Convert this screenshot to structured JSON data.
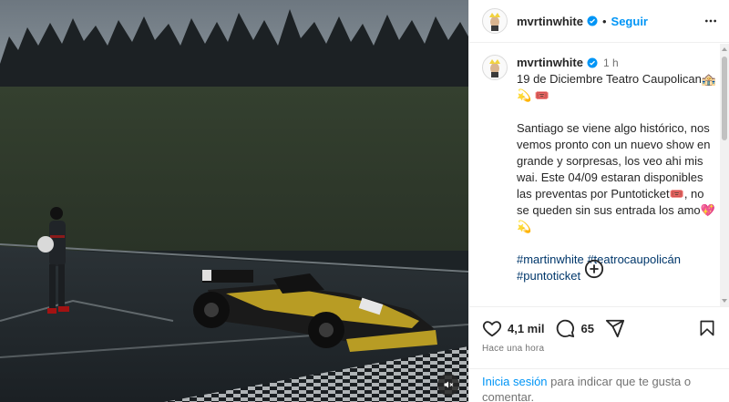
{
  "post": {
    "username": "mvrtinwhite",
    "follow_label": "Seguir",
    "dot": "•",
    "time_ago": "1 h",
    "caption_line1": "19 de Diciembre Teatro Caupolican🏤💫 🎟️",
    "caption_body": "Santiago se viene algo histórico, nos vemos pronto con un nuevo show en grande y sorpresas, los veo ahi mis wai. Este 04/09 estaran disponibles las preventas por Puntoticket🎟️, no se queden sin sus entrada los amo💖 💫",
    "hashtags": [
      "#martinwhite",
      "#teatrocaupolicán",
      "#puntoticket"
    ]
  },
  "actions": {
    "likes": "4,1 mil",
    "comments": "65",
    "posted_label": "Hace una hora"
  },
  "login_prompt": {
    "link": "Inicia sesión",
    "text": " para indicar que te gusta o comentar."
  },
  "icons": {
    "verified": "verified-badge-icon",
    "more": "more-options-icon",
    "like": "heart-icon",
    "comment": "comment-icon",
    "share": "share-icon",
    "save": "bookmark-icon",
    "load_more": "plus-circle-icon",
    "mute": "muted-speaker-icon"
  },
  "colors": {
    "link_blue": "#0095f6",
    "hashtag_blue": "#00376b",
    "muted_text": "#737373",
    "verified_blue": "#0095f6"
  }
}
